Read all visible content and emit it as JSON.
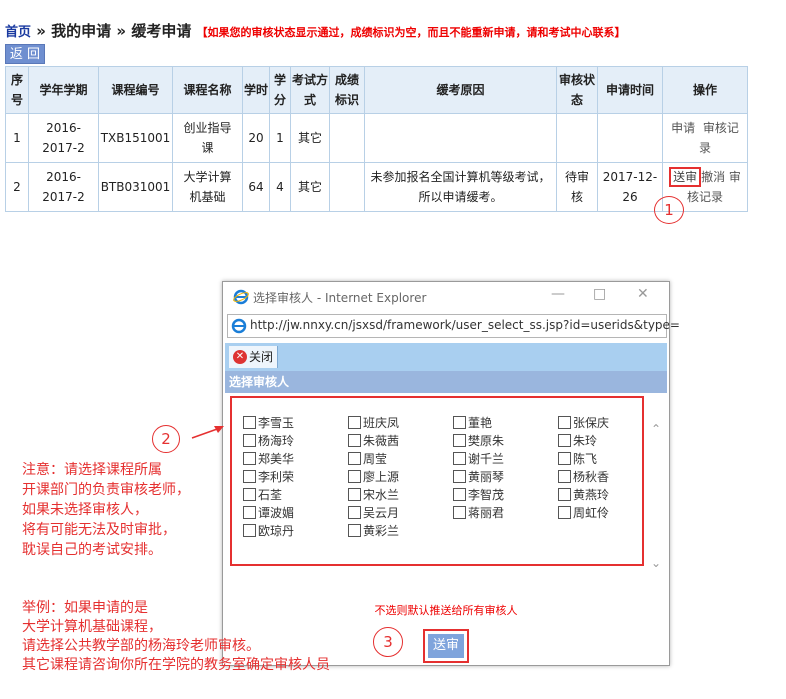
{
  "breadcrumb": {
    "home": "首页",
    "sep1": " » ",
    "item1": "我的申请",
    "sep2": " » ",
    "item2": "缓考申请",
    "note": "【如果您的审核状态显示通过，成绩标识为空，而且不能重新申请，请和考试中心联系】"
  },
  "back_label": "返 回",
  "table": {
    "headers": [
      {
        "l1": "序",
        "l2": "号"
      },
      {
        "l1": "学年学期",
        "l2": ""
      },
      {
        "l1": "课程编号",
        "l2": ""
      },
      {
        "l1": "课程名称",
        "l2": ""
      },
      {
        "l1": "学时",
        "l2": ""
      },
      {
        "l1": "学",
        "l2": "分"
      },
      {
        "l1": "考试方",
        "l2": "式"
      },
      {
        "l1": "成绩",
        "l2": "标识"
      },
      {
        "l1": "缓考原因",
        "l2": ""
      },
      {
        "l1": "审核状",
        "l2": "态"
      },
      {
        "l1": "申请时间",
        "l2": ""
      },
      {
        "l1": "操作",
        "l2": ""
      }
    ],
    "rows": [
      {
        "no": "1",
        "term1": "2016-",
        "term2": "2017-2",
        "code": "TXB151001",
        "name1": "创业指导",
        "name2": "课",
        "hours": "20",
        "credit": "1",
        "mode": "其它",
        "flag": "",
        "reason1": "",
        "reason2": "",
        "status1": "",
        "status2": "",
        "time1": "",
        "time2": "",
        "op1": "申请",
        "op2": "审核记",
        "op3": "录"
      },
      {
        "no": "2",
        "term1": "2016-",
        "term2": "2017-2",
        "code": "BTB031001",
        "name1": "大学计算",
        "name2": "机基础",
        "hours": "64",
        "credit": "4",
        "mode": "其它",
        "flag": "",
        "reason1": "未参加报名全国计算机等级考试，",
        "reason2": "所以申请缓考。",
        "status1": "待审",
        "status2": "核",
        "time1": "2017-12-",
        "time2": "26",
        "op1": "送审",
        "op2": "撤消",
        "op3": "审",
        "op4": "核记录"
      }
    ]
  },
  "steps": {
    "s1": "1",
    "s2": "2",
    "s3": "3"
  },
  "dialog": {
    "title": "选择审核人 - Internet Explorer",
    "url": "http://jw.nnxy.cn/jsxsd/framework/user_select_ss.jsp?id=userids&type=",
    "close_label": "关闭",
    "section_title": "选择审核人",
    "reviewers": [
      [
        "李雪玉",
        "班庆凤",
        "董艳",
        "张保庆"
      ],
      [
        "杨海玲",
        "朱薇茜",
        "樊原朱",
        "朱玲"
      ],
      [
        "郑美华",
        "周莹",
        "谢千兰",
        "陈飞"
      ],
      [
        "李利荣",
        "廖上源",
        "黄丽琴",
        "杨秋香"
      ],
      [
        "石荃",
        "宋水兰",
        "李智茂",
        "黄燕玲"
      ],
      [
        "谭波媚",
        "吴云月",
        "蒋丽君",
        "周虹伶"
      ],
      [
        "欧琼丹",
        "黄彩兰"
      ]
    ],
    "hint": "不选则默认推送给所有审核人",
    "send_label": "送审"
  },
  "annotations": {
    "note_lines": [
      "注意：请选择课程所属",
      "开课部门的负责审核老师，",
      "如果未选择审核人，",
      "将有可能无法及时审批，",
      "耽误自己的考试安排。"
    ],
    "example_lines": [
      "举例：如果申请的是",
      "大学计算机基础课程，",
      "请选择公共教学部的杨海玲老师审核。",
      "其它课程请咨询你所在学院的教务室确定审核人员"
    ]
  }
}
